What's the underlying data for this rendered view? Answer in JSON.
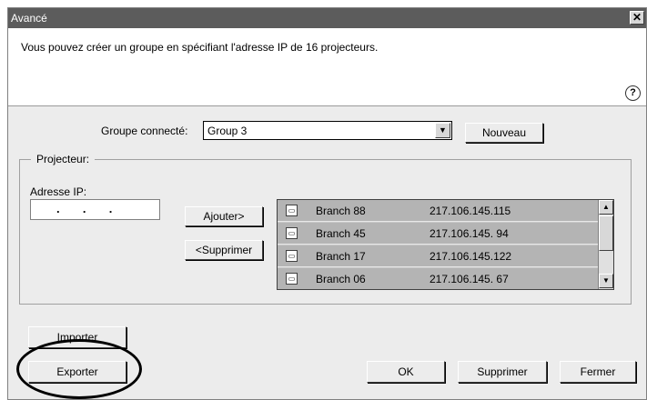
{
  "window": {
    "title": "Avancé",
    "close_glyph": "✕"
  },
  "header": {
    "text": "Vous pouvez créer un groupe en spécifiant l'adresse IP de 16 projecteurs.",
    "help_glyph": "?"
  },
  "group": {
    "label": "Groupe connecté:",
    "selected": "Group 3",
    "new_button": "Nouveau"
  },
  "projector": {
    "legend": "Projecteur:",
    "ip_label": "Adresse IP:",
    "ip_value": ".       .       .",
    "add_button": "Ajouter>",
    "remove_button": "<Supprimer",
    "items": [
      {
        "name": "Branch 88",
        "ip": "217.106.145.115"
      },
      {
        "name": "Branch 45",
        "ip": "217.106.145. 94"
      },
      {
        "name": "Branch 17",
        "ip": "217.106.145.122"
      },
      {
        "name": "Branch 06",
        "ip": "217.106.145. 67"
      }
    ]
  },
  "buttons": {
    "import": "Importer",
    "export": "Exporter",
    "ok": "OK",
    "delete": "Supprimer",
    "close": "Fermer"
  },
  "icons": {
    "close": "close-icon",
    "help": "help-icon",
    "dropdown": "chevron-down-icon",
    "projector": "projector-icon"
  }
}
